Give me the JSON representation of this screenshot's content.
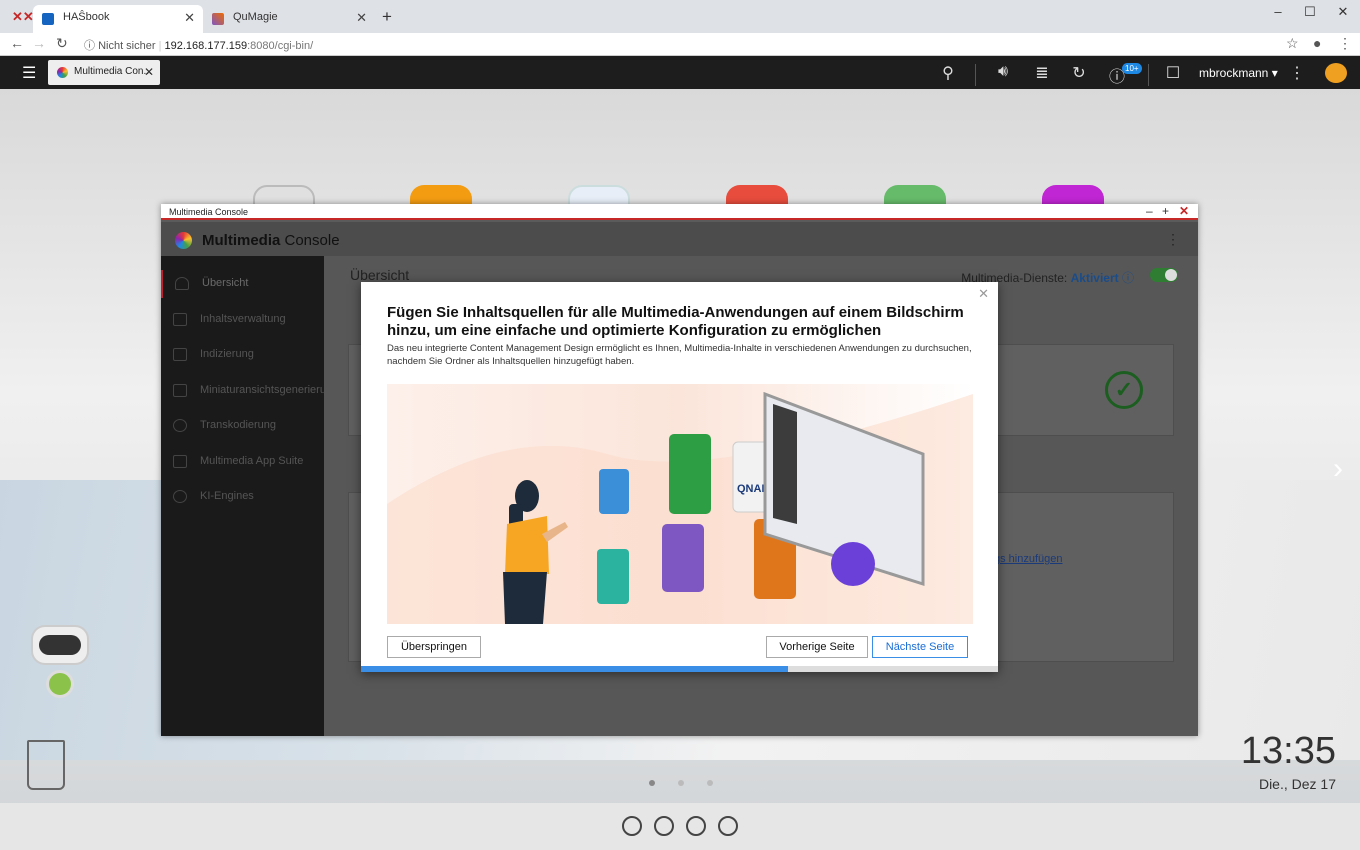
{
  "browser": {
    "tabs": [
      {
        "label": "HAŜbook",
        "active": true
      },
      {
        "label": "QuMagie",
        "active": false
      }
    ],
    "new_tab": "+",
    "url_security": "Nicht sicher",
    "url_host": "192.168.177.159",
    "url_rest": ":8080/cgi-bin/"
  },
  "qts": {
    "app_tab": "Multimedia Con...",
    "notification_badge": "10+",
    "username": "mbrockmann"
  },
  "window": {
    "title": "Multimedia Console",
    "header_bold": "Multimedia",
    "header_light": " Console"
  },
  "sidebar": {
    "items": [
      {
        "label": "Übersicht",
        "icon": "speedometer-icon"
      },
      {
        "label": "Inhaltsverwaltung",
        "icon": "folder-image-icon"
      },
      {
        "label": "Indizierung",
        "icon": "list-icon"
      },
      {
        "label": "Miniaturansichtsgenerieru...",
        "icon": "image-icon"
      },
      {
        "label": "Transkodierung",
        "icon": "transcode-icon"
      },
      {
        "label": "Multimedia App Suite",
        "icon": "grid-icon"
      },
      {
        "label": "KI-Engines",
        "icon": "brain-icon"
      }
    ]
  },
  "main": {
    "title": "Übersicht",
    "service_label": "Multimedia-Dienste:",
    "service_status": "Aktiviert",
    "link_fragment": "gs hinzufügen"
  },
  "modal": {
    "heading": "Fügen Sie Inhaltsquellen für alle Multimedia-Anwendungen auf einem Bildschirm hinzu, um eine einfache und optimierte Konfiguration zu ermöglichen",
    "description": "Das neu integrierte Content Management Design ermöglicht es Ihnen, Multimedia-Inhalte in verschiedenen Anwendungen zu durchsuchen, nachdem Sie Ordner als Inhaltsquellen hinzugefügt haben.",
    "skip_label": "Überspringen",
    "prev_label": "Vorherige Seite",
    "next_label": "Nächste Seite",
    "progress": 0.67,
    "illustration_logo": "QNAP"
  },
  "desktop": {
    "time": "13:35",
    "date": "Die., Dez 17"
  },
  "colors": {
    "accent": "#3a8ee6",
    "window_title_border": "#c62828",
    "service_status": "#1a4c8a"
  }
}
